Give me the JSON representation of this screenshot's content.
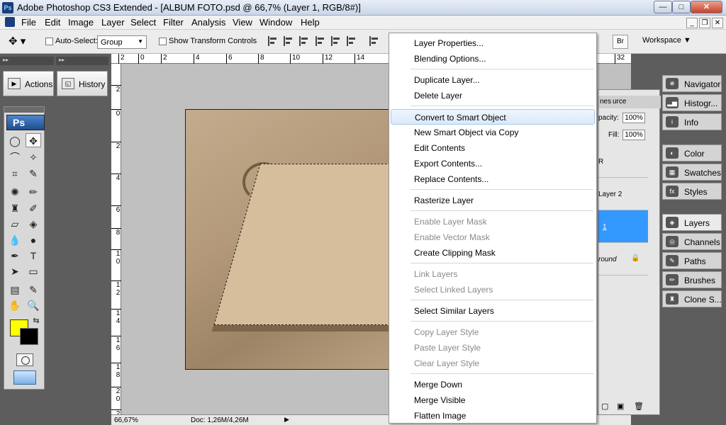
{
  "window": {
    "title": "Adobe Photoshop CS3 Extended - [ALBUM FOTO.psd @ 66,7% (Layer 1, RGB/8#)]",
    "app_icon": "Ps",
    "controls": {
      "minimize": "—",
      "maximize": "□",
      "close": "✕"
    }
  },
  "menubar": {
    "items": [
      "File",
      "Edit",
      "Image",
      "Layer",
      "Select",
      "Filter",
      "Analysis",
      "View",
      "Window",
      "Help"
    ]
  },
  "options_bar": {
    "auto_select_label": "Auto-Select:",
    "auto_select_value": "Group",
    "show_transform_label": "Show Transform Controls",
    "workspace_label": "Workspace ▼"
  },
  "left_panels": {
    "actions_label": "Actions",
    "history_label": "History"
  },
  "toolbox": {
    "badge": "Ps",
    "foreground_color": "#ffff00",
    "background_color": "#000000"
  },
  "rulers": {
    "top": [
      "2",
      "0",
      "2",
      "4",
      "6",
      "8",
      "10",
      "12",
      "14",
      "32"
    ],
    "left": [
      "2",
      "0",
      "2",
      "4",
      "6",
      "8",
      "10",
      "12",
      "14",
      "16",
      "18",
      "20",
      "22"
    ]
  },
  "status_bar": {
    "zoom": "66,67%",
    "doc": "Doc: 1,26M/4,26M"
  },
  "layers_panel": {
    "tab_partial_1": "nes",
    "tab_partial_2": "urce",
    "opacity_label": "pacity:",
    "opacity_value": "100%",
    "fill_label": "Fill:",
    "fill_value": "100%",
    "layer_rows": [
      "R",
      "Layer 2",
      "1",
      "round"
    ]
  },
  "right_dock": {
    "group1": [
      "Navigator",
      "Histogr...",
      "Info"
    ],
    "group2": [
      "Color",
      "Swatches",
      "Styles"
    ],
    "group3": [
      "Layers",
      "Channels",
      "Paths",
      "Brushes",
      "Clone S..."
    ]
  },
  "context_menu": {
    "groups": [
      [
        {
          "label": "Layer Properties...",
          "enabled": true
        },
        {
          "label": "Blending Options...",
          "enabled": true
        }
      ],
      [
        {
          "label": "Duplicate Layer...",
          "enabled": true
        },
        {
          "label": "Delete Layer",
          "enabled": true
        }
      ],
      [
        {
          "label": "Convert to Smart Object",
          "enabled": true,
          "highlighted": true
        },
        {
          "label": "New Smart Object via Copy",
          "enabled": true
        },
        {
          "label": "Edit Contents",
          "enabled": true
        },
        {
          "label": "Export Contents...",
          "enabled": true
        },
        {
          "label": "Replace Contents...",
          "enabled": true
        }
      ],
      [
        {
          "label": "Rasterize Layer",
          "enabled": true
        }
      ],
      [
        {
          "label": "Enable Layer Mask",
          "enabled": false
        },
        {
          "label": "Enable Vector Mask",
          "enabled": false
        },
        {
          "label": "Create Clipping Mask",
          "enabled": true
        }
      ],
      [
        {
          "label": "Link Layers",
          "enabled": false
        },
        {
          "label": "Select Linked Layers",
          "enabled": false
        }
      ],
      [
        {
          "label": "Select Similar Layers",
          "enabled": true
        }
      ],
      [
        {
          "label": "Copy Layer Style",
          "enabled": false
        },
        {
          "label": "Paste Layer Style",
          "enabled": false
        },
        {
          "label": "Clear Layer Style",
          "enabled": false
        }
      ],
      [
        {
          "label": "Merge Down",
          "enabled": true
        },
        {
          "label": "Merge Visible",
          "enabled": true
        },
        {
          "label": "Flatten Image",
          "enabled": true
        }
      ]
    ]
  },
  "colors": {
    "selected_layer": "#3399ff",
    "highlight": "#dbe9f9"
  }
}
